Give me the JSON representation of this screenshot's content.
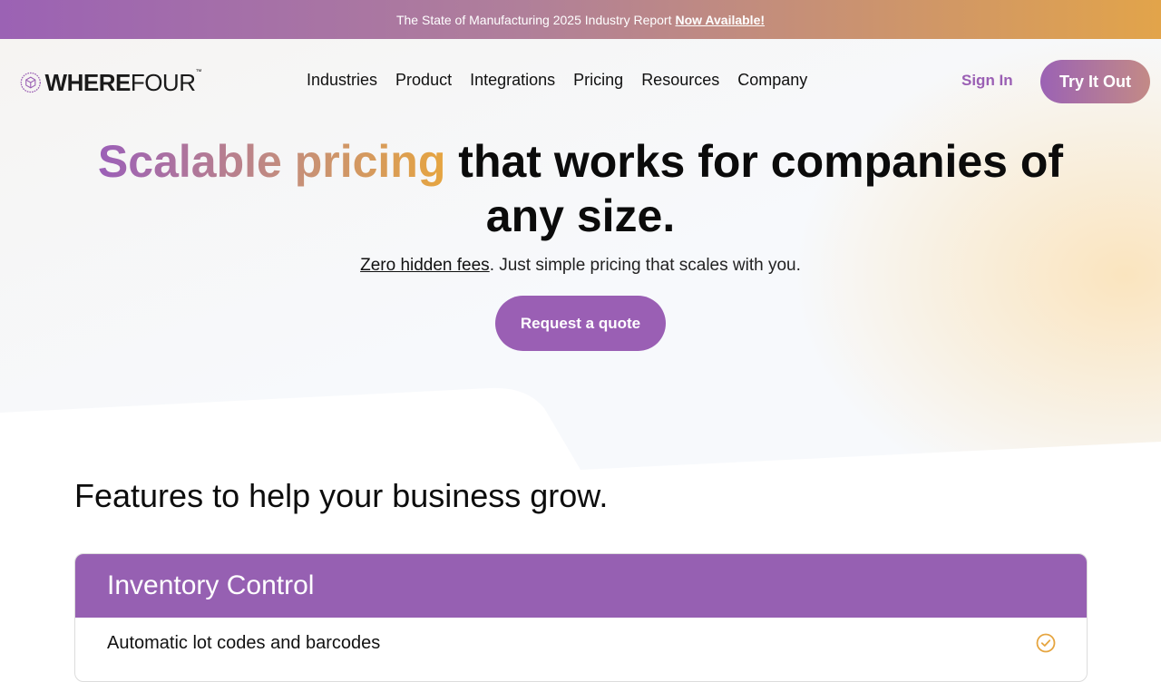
{
  "banner": {
    "text": "The State of Manufacturing 2025 Industry Report",
    "link": "Now Available!"
  },
  "header": {
    "logo": {
      "bold": "WHERE",
      "regular": "FOUR",
      "tm": "™"
    },
    "nav": [
      {
        "label": "Industries"
      },
      {
        "label": "Product"
      },
      {
        "label": "Integrations"
      },
      {
        "label": "Pricing"
      },
      {
        "label": "Resources"
      },
      {
        "label": "Company"
      }
    ],
    "sign_in": "Sign In",
    "cta": "Try It Out"
  },
  "hero": {
    "headline_highlight": "Scalable pricing",
    "headline_rest": " that works for companies of any size.",
    "sub_link": "Zero hidden fees",
    "sub_rest": ". Just simple pricing that scales with you.",
    "button": "Request a quote"
  },
  "features": {
    "title": "Features to help your business grow.",
    "card": {
      "title": "Inventory Control",
      "rows": [
        {
          "label": "Automatic lot codes and barcodes",
          "icon": "check-circle-icon"
        }
      ]
    }
  },
  "colors": {
    "brand_purple": "#9a5fb4",
    "brand_orange": "#e6a540"
  }
}
